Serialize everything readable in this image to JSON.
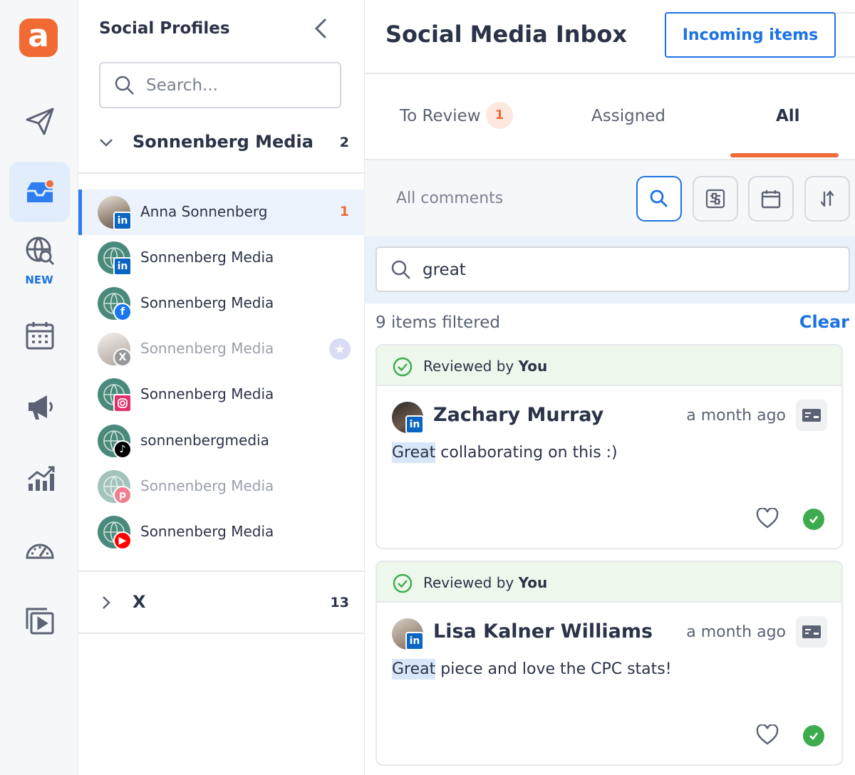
{
  "rail": {
    "new_label": "NEW"
  },
  "profiles": {
    "title": "Social Profiles",
    "search_placeholder": "Search...",
    "groups": [
      {
        "name": "Sonnenberg Media",
        "count": "2"
      },
      {
        "name": "X",
        "count": "13"
      }
    ],
    "items": [
      {
        "name": "Anna Sonnenberg",
        "network": "linkedin",
        "count": "1"
      },
      {
        "name": "Sonnenberg Media",
        "network": "linkedin"
      },
      {
        "name": "Sonnenberg Media",
        "network": "facebook"
      },
      {
        "name": "Sonnenberg Media",
        "network": "x"
      },
      {
        "name": "Sonnenberg Media",
        "network": "instagram"
      },
      {
        "name": "sonnenbergmedia",
        "network": "tiktok"
      },
      {
        "name": "Sonnenberg Media",
        "network": "pinterest"
      },
      {
        "name": "Sonnenberg Media",
        "network": "youtube"
      }
    ]
  },
  "main": {
    "title": "Social Media Inbox",
    "incoming_button": "Incoming items",
    "tabs": [
      {
        "label": "To Review",
        "badge": "1"
      },
      {
        "label": "Assigned"
      },
      {
        "label": "All"
      }
    ],
    "filter_label": "All comments",
    "search_value": "great",
    "filtered_count": "9 items filtered",
    "clear_label": "Clear",
    "cards": [
      {
        "status_prefix": "Reviewed by",
        "status_user": "You",
        "author": "Zachary Murray",
        "time": "a month ago",
        "highlight": "Great",
        "text": " collaborating on this :)"
      },
      {
        "status_prefix": "Reviewed by",
        "status_user": "You",
        "author": "Lisa Kalner Williams",
        "time": "a month ago",
        "highlight": "Great",
        "text": " piece and love the CPC stats!"
      }
    ]
  },
  "colors": {
    "accent_orange": "#ef6b3a",
    "accent_blue": "#1d73e3",
    "reviewed_green": "#3cac4f"
  }
}
